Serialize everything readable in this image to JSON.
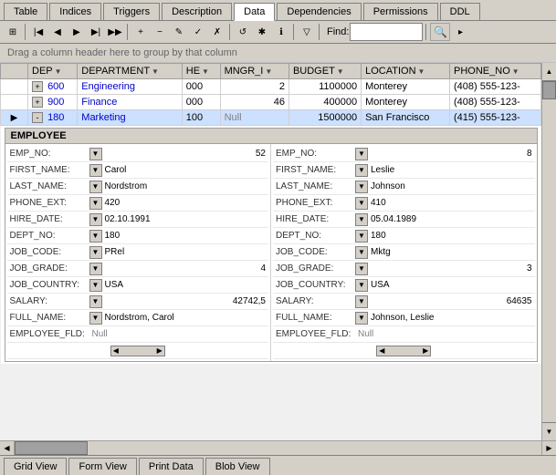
{
  "tabs": [
    {
      "label": "Table",
      "active": false
    },
    {
      "label": "Indices",
      "active": false
    },
    {
      "label": "Triggers",
      "active": false
    },
    {
      "label": "Description",
      "active": false
    },
    {
      "label": "Data",
      "active": true
    },
    {
      "label": "Dependencies",
      "active": false
    },
    {
      "label": "Permissions",
      "active": false
    },
    {
      "label": "DDL",
      "active": false
    }
  ],
  "toolbar": {
    "find_label": "Find:",
    "find_placeholder": ""
  },
  "group_header": "Drag a column header here to group by that column",
  "columns": [
    {
      "name": "DEP",
      "sort": "▼"
    },
    {
      "name": "DEPARTMENT",
      "sort": "▼"
    },
    {
      "name": "HE",
      "sort": "▼"
    },
    {
      "name": "MNGR_I",
      "sort": "▼"
    },
    {
      "name": "BUDGET",
      "sort": "▼"
    },
    {
      "name": "LOCATION",
      "sort": "▼"
    },
    {
      "name": "PHONE_NO",
      "sort": "▼"
    }
  ],
  "rows": [
    {
      "expand": "+",
      "dep": "600",
      "department": "Engineering",
      "he": "000",
      "mngr_i": "2",
      "budget": "1100000",
      "location": "Monterey",
      "phone": "(408) 555-123-"
    },
    {
      "expand": "+",
      "dep": "900",
      "department": "Finance",
      "he": "000",
      "mngr_i": "46",
      "budget": "400000",
      "location": "Monterey",
      "phone": "(408) 555-123-"
    },
    {
      "expand": "-",
      "dep": "180",
      "department": "Marketing",
      "he": "100",
      "mngr_i": "Null",
      "budget": "1500000",
      "location": "San Francisco",
      "phone": "(415) 555-123-"
    }
  ],
  "employee_section": {
    "header": "EMPLOYEE",
    "left_panel": {
      "emp_no": {
        "label": "EMP_NO:",
        "value": "52",
        "align": "right"
      },
      "first_name": {
        "label": "FIRST_NAME:",
        "value": "Carol"
      },
      "last_name": {
        "label": "LAST_NAME:",
        "value": "Nordstrom"
      },
      "phone_ext": {
        "label": "PHONE_EXT:",
        "value": "420"
      },
      "hire_date": {
        "label": "HIRE_DATE:",
        "value": "02.10.1991"
      },
      "dept_no": {
        "label": "DEPT_NO:",
        "value": "180"
      },
      "job_code": {
        "label": "JOB_CODE:",
        "value": "PRel"
      },
      "job_grade": {
        "label": "JOB_GRADE:",
        "value": "4",
        "align": "right"
      },
      "job_country": {
        "label": "JOB_COUNTRY:",
        "value": "USA"
      },
      "salary": {
        "label": "SALARY:",
        "value": "42742,5",
        "align": "right"
      },
      "full_name": {
        "label": "FULL_NAME:",
        "value": "Nordstrom, Carol"
      },
      "employee_fld": {
        "label": "EMPLOYEE_FLD:",
        "value": "Null",
        "null": true
      }
    },
    "right_panel": {
      "emp_no": {
        "label": "EMP_NO:",
        "value": "8",
        "align": "right"
      },
      "first_name": {
        "label": "FIRST_NAME:",
        "value": "Leslie"
      },
      "last_name": {
        "label": "LAST_NAME:",
        "value": "Johnson"
      },
      "phone_ext": {
        "label": "PHONE_EXT:",
        "value": "410"
      },
      "hire_date": {
        "label": "HIRE_DATE:",
        "value": "05.04.1989"
      },
      "dept_no": {
        "label": "DEPT_NO:",
        "value": "180"
      },
      "job_code": {
        "label": "JOB_CODE:",
        "value": "Mktg"
      },
      "job_grade": {
        "label": "JOB_GRADE:",
        "value": "3",
        "align": "right"
      },
      "job_country": {
        "label": "JOB_COUNTRY:",
        "value": "USA"
      },
      "salary": {
        "label": "SALARY:",
        "value": "64635",
        "align": "right"
      },
      "full_name": {
        "label": "FULL_NAME:",
        "value": "Johnson, Leslie"
      },
      "employee_fld": {
        "label": "EMPLOYEE_FLD:",
        "value": "Null",
        "null": true
      }
    }
  },
  "bottom_tabs": [
    {
      "label": "Grid View",
      "active": false
    },
    {
      "label": "Form View",
      "active": false
    },
    {
      "label": "Print Data",
      "active": false
    },
    {
      "label": "Blob View",
      "active": false
    }
  ]
}
